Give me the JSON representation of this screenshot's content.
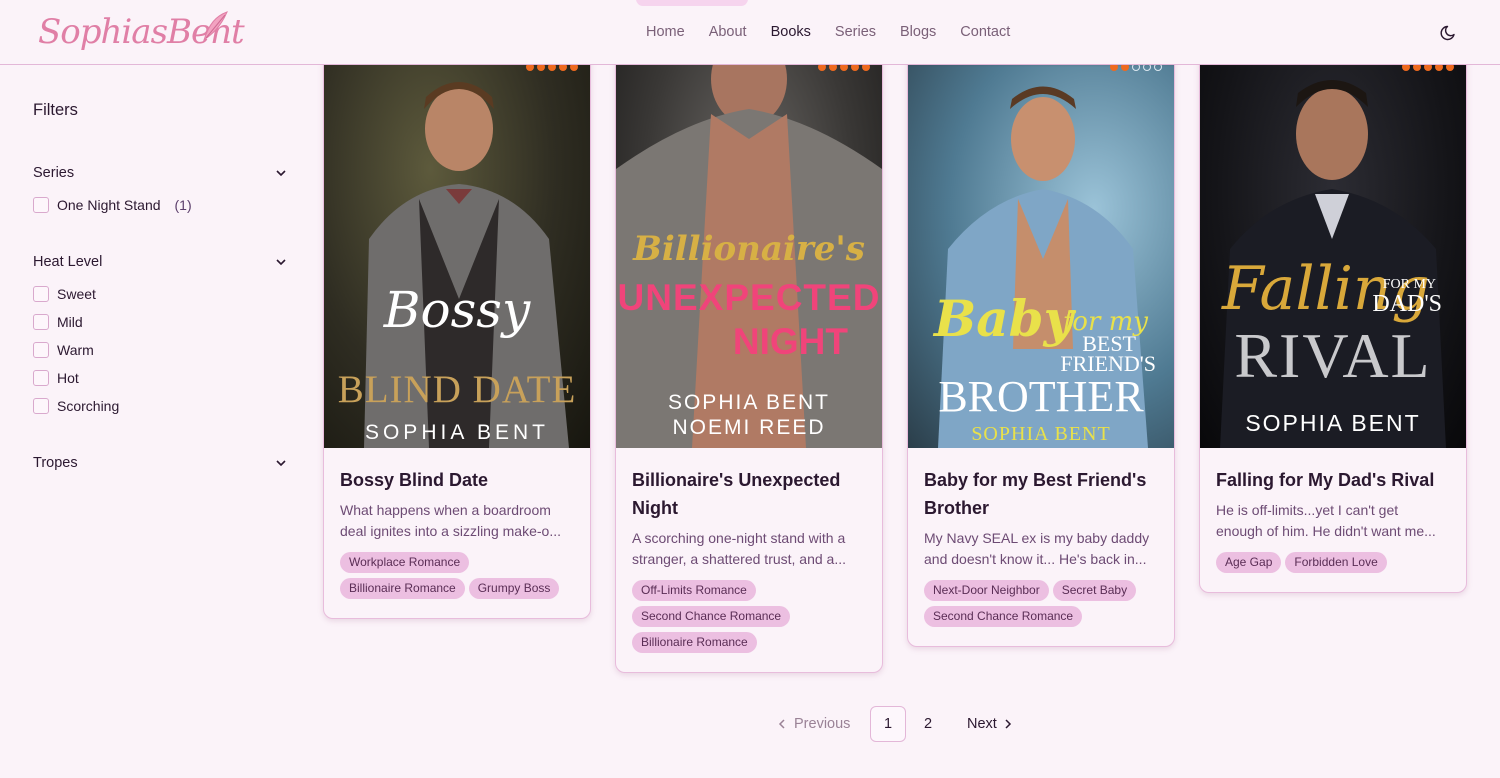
{
  "brand": {
    "logo_text": "SophiasBent"
  },
  "nav": {
    "items": [
      "Home",
      "About",
      "Books",
      "Series",
      "Blogs",
      "Contact"
    ],
    "active": "Books"
  },
  "filters": {
    "title": "Filters",
    "series": {
      "label": "Series",
      "options": [
        {
          "label": "One Night Stand",
          "count": "(1)"
        }
      ]
    },
    "heat": {
      "label": "Heat Level",
      "options": [
        "Sweet",
        "Mild",
        "Warm",
        "Hot",
        "Scorching"
      ]
    },
    "tropes": {
      "label": "Tropes"
    }
  },
  "books": [
    {
      "title": "Bossy Blind Date",
      "desc": [
        "What happens when a boardroom",
        "deal ignites into a sizzling make-o..."
      ],
      "tags": [
        "Workplace Romance",
        "Billionaire Romance",
        "Grumpy Boss"
      ],
      "rating": 5,
      "cover": {
        "line1": "Bossy",
        "line2": "BLIND DATE",
        "author": "SOPHIA BENT"
      }
    },
    {
      "title": "Billionaire's Unexpected Night",
      "desc": [
        "A scorching one-night stand with a",
        "stranger, a shattered trust, and a..."
      ],
      "tags": [
        "Off-Limits Romance",
        "Second Chance Romance",
        "Billionaire Romance"
      ],
      "rating": 5,
      "cover": {
        "line1": "Billionaire's",
        "line2": "UNEXPECTED",
        "line3": "NIGHT",
        "author": "SOPHIA BENT",
        "author2": "NOEMI REED"
      }
    },
    {
      "title": "Baby for my Best Friend's Brother",
      "desc": [
        "My Navy SEAL ex is my baby daddy",
        "and doesn't know it... He's back in..."
      ],
      "tags": [
        "Next-Door Neighbor",
        "Secret Baby",
        "Second Chance Romance"
      ],
      "rating": 2,
      "cover": {
        "line1": "Baby",
        "line1b": "for my",
        "line2": "BEST",
        "line3": "FRIEND'S",
        "line4": "BROTHER",
        "author": "SOPHIA BENT"
      }
    },
    {
      "title": "Falling for My Dad's Rival",
      "desc": [
        "He is off-limits...yet I can't get",
        "enough of him. He didn't want me..."
      ],
      "tags": [
        "Age Gap",
        "Forbidden Love"
      ],
      "rating": 5,
      "cover": {
        "line1": "Falling",
        "line2": "FOR MY",
        "line3": "DAD'S",
        "line4": "RIVAL",
        "author": "SOPHIA BENT"
      }
    }
  ],
  "pagination": {
    "prev": "Previous",
    "pages": [
      "1",
      "2"
    ],
    "current": "1",
    "next": "Next"
  },
  "colors": {
    "background": "#fbf3f9",
    "accent": "#ecbfe1",
    "rating": "#ee6a1f",
    "border": "#e3b7d8"
  }
}
